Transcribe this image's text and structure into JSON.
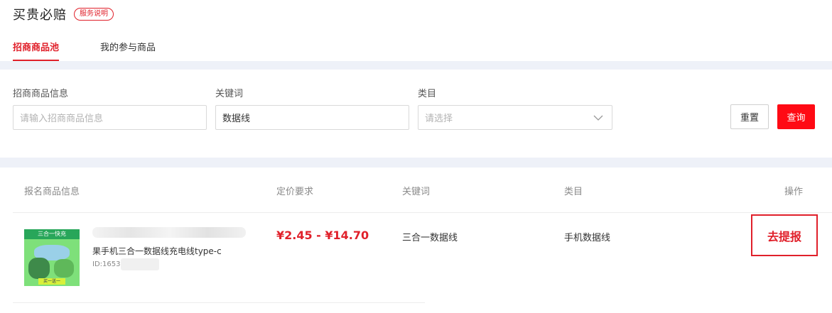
{
  "header": {
    "title": "买贵必赔",
    "badge": "服务说明"
  },
  "tabs": [
    {
      "label": "招商商品池",
      "active": true
    },
    {
      "label": "我的参与商品",
      "active": false
    }
  ],
  "filters": {
    "product_info": {
      "label": "招商商品信息",
      "placeholder": "请输入招商商品信息",
      "value": ""
    },
    "keyword": {
      "label": "关键词",
      "value": "数据线"
    },
    "category": {
      "label": "类目",
      "placeholder": "请选择",
      "icon": "chevron-down-icon"
    },
    "reset_label": "重置",
    "query_label": "查询"
  },
  "table": {
    "headers": {
      "product": "报名商品信息",
      "price": "定价要求",
      "keyword": "关键词",
      "category": "类目",
      "action": "操作"
    },
    "rows": [
      {
        "thumb_text": "三合一快充",
        "thumb_bottom": "买一送一",
        "title": "果手机三合一数据线充电线type-c",
        "id": "ID:1653",
        "price": "¥2.45 - ¥14.70",
        "keyword": "三合一数据线",
        "category": "手机数据线",
        "action": "去提报"
      }
    ]
  },
  "colors": {
    "accent": "#e0202a",
    "query_button": "#ff0a14",
    "band": "#eef1f8"
  }
}
